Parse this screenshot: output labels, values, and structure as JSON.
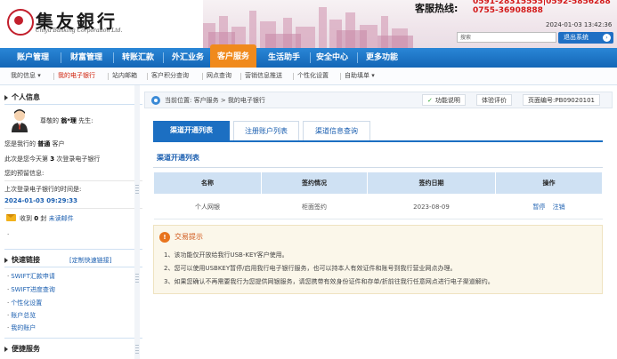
{
  "header": {
    "bank_name": "集友銀行",
    "bank_name_en": "Chiyu Banking Corporation Ltd.",
    "hotline_label": "客服热线:",
    "hotline_numbers": "0591-28315555|0592-5856288\n0755-36908888",
    "datetime": "2024-01-03 13:42:36",
    "search_placeholder": "搜索",
    "logout_label": "退出系统"
  },
  "main_nav": [
    "账户管理",
    "财富管理",
    "转账汇款",
    "外汇业务",
    "客户服务",
    "生活助手",
    "安全中心",
    "更多功能"
  ],
  "main_nav_active": "客户服务",
  "sub_nav": [
    "我的信息",
    "我的电子银行",
    "站内邮箱",
    "客户积分查询",
    "网点查询",
    "营销信息推送",
    "个性化设置",
    "自助填单"
  ],
  "sub_nav_active": "我的电子银行",
  "sidebar": {
    "personal_title": "个人信息",
    "greeting_prefix": "尊敬的",
    "user_name": "翁*理",
    "greeting_suffix": "先生:",
    "level_prefix": "您是我行的",
    "level": "普通",
    "level_suffix": "客户",
    "days_prefix": "此次是您今天第",
    "days_count": "3",
    "days_suffix": "次登录电子银行",
    "reserved_info_label": "您的预留信息:",
    "last_login_label": "上次登录电子银行的时间是:",
    "last_login_time": "2024-01-03 09:29:33",
    "mail_prefix": "收到",
    "mail_count": "0",
    "mail_suffix": "封",
    "mail_link": "未读邮件",
    "quick_title": "快速链接",
    "quick_custom": "[定制快速链接]",
    "quick_links": [
      "SWIFT汇款申请",
      "SWIFT进度查询",
      "个性化设置",
      "账户总览",
      "我的账户"
    ],
    "convenient_title": "便捷服务"
  },
  "breadcrumb": {
    "current_label": "当前位置:",
    "path": "客户服务 > 我的电子银行",
    "help_label": "功能说明",
    "rating_label": "体验评价",
    "page_code": "页面编号:PB09020101"
  },
  "tabs": [
    "渠道开通列表",
    "注册账户列表",
    "渠道信息查询"
  ],
  "active_tab": "渠道开通列表",
  "panel_title": "渠道开通列表",
  "table": {
    "headers": [
      "名称",
      "签约情况",
      "签约日期",
      "操作"
    ],
    "rows": [
      {
        "name": "个人网银",
        "status": "柜面签约",
        "date": "2023-08-09",
        "actions": [
          "暂停",
          "注销"
        ]
      }
    ]
  },
  "tips": {
    "title": "交易提示",
    "lines": [
      "1、该功能仅开放给我行USB-KEY客户使用。",
      "2、您可以使用USBKEY暂停/启用我行电子银行服务，也可以持本人有效证件和账号到我行营业网点办理。",
      "3、如果您确认不再需要我行为您提供网银服务，请您携带有效身份证件和存单/折前往我行任意网点进行电子渠道解约。"
    ]
  },
  "colors": {
    "primary_blue": "#1c6fc2",
    "nav_active_orange": "#f08a1c",
    "alert_red": "#d31818"
  }
}
